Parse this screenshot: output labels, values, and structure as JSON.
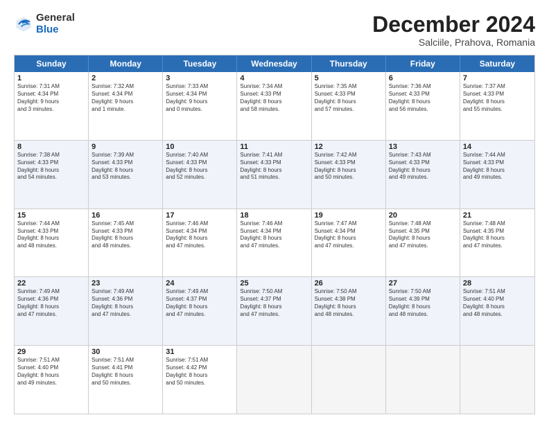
{
  "logo": {
    "general": "General",
    "blue": "Blue"
  },
  "title": "December 2024",
  "subtitle": "Salciile, Prahova, Romania",
  "days_of_week": [
    "Sunday",
    "Monday",
    "Tuesday",
    "Wednesday",
    "Thursday",
    "Friday",
    "Saturday"
  ],
  "weeks": [
    [
      {
        "day": "1",
        "info": "Sunrise: 7:31 AM\nSunset: 4:34 PM\nDaylight: 9 hours\nand 3 minutes."
      },
      {
        "day": "2",
        "info": "Sunrise: 7:32 AM\nSunset: 4:34 PM\nDaylight: 9 hours\nand 1 minute."
      },
      {
        "day": "3",
        "info": "Sunrise: 7:33 AM\nSunset: 4:34 PM\nDaylight: 9 hours\nand 0 minutes."
      },
      {
        "day": "4",
        "info": "Sunrise: 7:34 AM\nSunset: 4:33 PM\nDaylight: 8 hours\nand 58 minutes."
      },
      {
        "day": "5",
        "info": "Sunrise: 7:35 AM\nSunset: 4:33 PM\nDaylight: 8 hours\nand 57 minutes."
      },
      {
        "day": "6",
        "info": "Sunrise: 7:36 AM\nSunset: 4:33 PM\nDaylight: 8 hours\nand 56 minutes."
      },
      {
        "day": "7",
        "info": "Sunrise: 7:37 AM\nSunset: 4:33 PM\nDaylight: 8 hours\nand 55 minutes."
      }
    ],
    [
      {
        "day": "8",
        "info": "Sunrise: 7:38 AM\nSunset: 4:33 PM\nDaylight: 8 hours\nand 54 minutes."
      },
      {
        "day": "9",
        "info": "Sunrise: 7:39 AM\nSunset: 4:33 PM\nDaylight: 8 hours\nand 53 minutes."
      },
      {
        "day": "10",
        "info": "Sunrise: 7:40 AM\nSunset: 4:33 PM\nDaylight: 8 hours\nand 52 minutes."
      },
      {
        "day": "11",
        "info": "Sunrise: 7:41 AM\nSunset: 4:33 PM\nDaylight: 8 hours\nand 51 minutes."
      },
      {
        "day": "12",
        "info": "Sunrise: 7:42 AM\nSunset: 4:33 PM\nDaylight: 8 hours\nand 50 minutes."
      },
      {
        "day": "13",
        "info": "Sunrise: 7:43 AM\nSunset: 4:33 PM\nDaylight: 8 hours\nand 49 minutes."
      },
      {
        "day": "14",
        "info": "Sunrise: 7:44 AM\nSunset: 4:33 PM\nDaylight: 8 hours\nand 49 minutes."
      }
    ],
    [
      {
        "day": "15",
        "info": "Sunrise: 7:44 AM\nSunset: 4:33 PM\nDaylight: 8 hours\nand 48 minutes."
      },
      {
        "day": "16",
        "info": "Sunrise: 7:45 AM\nSunset: 4:33 PM\nDaylight: 8 hours\nand 48 minutes."
      },
      {
        "day": "17",
        "info": "Sunrise: 7:46 AM\nSunset: 4:34 PM\nDaylight: 8 hours\nand 47 minutes."
      },
      {
        "day": "18",
        "info": "Sunrise: 7:46 AM\nSunset: 4:34 PM\nDaylight: 8 hours\nand 47 minutes."
      },
      {
        "day": "19",
        "info": "Sunrise: 7:47 AM\nSunset: 4:34 PM\nDaylight: 8 hours\nand 47 minutes."
      },
      {
        "day": "20",
        "info": "Sunrise: 7:48 AM\nSunset: 4:35 PM\nDaylight: 8 hours\nand 47 minutes."
      },
      {
        "day": "21",
        "info": "Sunrise: 7:48 AM\nSunset: 4:35 PM\nDaylight: 8 hours\nand 47 minutes."
      }
    ],
    [
      {
        "day": "22",
        "info": "Sunrise: 7:49 AM\nSunset: 4:36 PM\nDaylight: 8 hours\nand 47 minutes."
      },
      {
        "day": "23",
        "info": "Sunrise: 7:49 AM\nSunset: 4:36 PM\nDaylight: 8 hours\nand 47 minutes."
      },
      {
        "day": "24",
        "info": "Sunrise: 7:49 AM\nSunset: 4:37 PM\nDaylight: 8 hours\nand 47 minutes."
      },
      {
        "day": "25",
        "info": "Sunrise: 7:50 AM\nSunset: 4:37 PM\nDaylight: 8 hours\nand 47 minutes."
      },
      {
        "day": "26",
        "info": "Sunrise: 7:50 AM\nSunset: 4:38 PM\nDaylight: 8 hours\nand 48 minutes."
      },
      {
        "day": "27",
        "info": "Sunrise: 7:50 AM\nSunset: 4:39 PM\nDaylight: 8 hours\nand 48 minutes."
      },
      {
        "day": "28",
        "info": "Sunrise: 7:51 AM\nSunset: 4:40 PM\nDaylight: 8 hours\nand 48 minutes."
      }
    ],
    [
      {
        "day": "29",
        "info": "Sunrise: 7:51 AM\nSunset: 4:40 PM\nDaylight: 8 hours\nand 49 minutes."
      },
      {
        "day": "30",
        "info": "Sunrise: 7:51 AM\nSunset: 4:41 PM\nDaylight: 8 hours\nand 50 minutes."
      },
      {
        "day": "31",
        "info": "Sunrise: 7:51 AM\nSunset: 4:42 PM\nDaylight: 8 hours\nand 50 minutes."
      },
      {
        "day": "",
        "info": ""
      },
      {
        "day": "",
        "info": ""
      },
      {
        "day": "",
        "info": ""
      },
      {
        "day": "",
        "info": ""
      }
    ]
  ]
}
